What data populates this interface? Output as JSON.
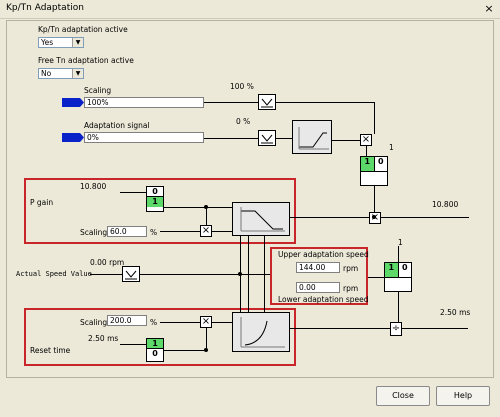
{
  "window": {
    "title": "Kp/Tn Adaptation",
    "close_glyph": "×"
  },
  "kp_tn_active": {
    "label": "Kp/Tn adaptation active",
    "value": "Yes"
  },
  "free_tn_active": {
    "label": "Free Tn adaptation active",
    "value": "No"
  },
  "scaling": {
    "label": "Scaling",
    "value": "100%",
    "output": "100 %"
  },
  "adaptation_signal": {
    "label": "Adaptation signal",
    "value": "0%",
    "output": "0 %"
  },
  "p_gain": {
    "label": "P gain",
    "input_value": "10.800",
    "scaling_label": "Scaling",
    "scaling_value": "60.0",
    "unit": "%",
    "output": "10.800"
  },
  "actual_speed": {
    "label": "Actual Speed Value",
    "value": "0.00 rpm"
  },
  "upper_speed": {
    "label": "Upper adaptation speed",
    "value": "144.00",
    "unit": "rpm"
  },
  "lower_speed": {
    "label": "Lower adaptation speed",
    "value": "0.00",
    "unit": "rpm"
  },
  "reset_time": {
    "label": "Reset time",
    "input_value": "2.50 ms",
    "scaling_label": "Scaling",
    "scaling_value": "200.0",
    "unit": "%",
    "output": "2.50 ms"
  },
  "switches": {
    "top_number": "1",
    "mid_number": "1",
    "one": "1",
    "zero": "0"
  },
  "buttons": {
    "close": "Close",
    "help": "Help"
  },
  "colors": {
    "highlight_border": "#c8262b",
    "switch_active": "#5dd96a",
    "signal_arrow": "#0a20c8",
    "background": "#ece9d8"
  }
}
